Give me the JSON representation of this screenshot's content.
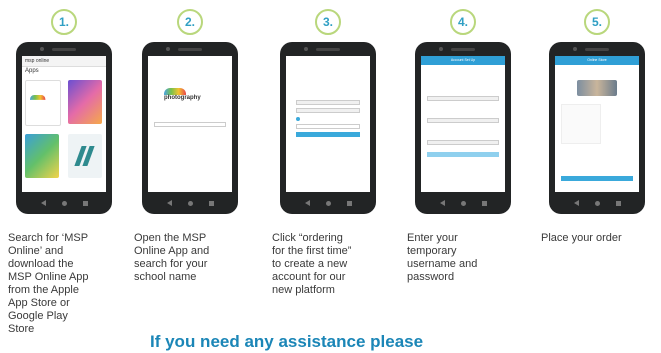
{
  "steps": [
    {
      "number": "1.",
      "caption": "Search for ‘MSP\nOnline’ and\ndownload the\nMSP Online App\nfrom the Apple\nApp Store or\nGoogle Play\nStore",
      "screen": {
        "search_text": "msp online",
        "section": "Apps"
      }
    },
    {
      "number": "2.",
      "caption": "Open the MSP\nOnline App and\nsearch for your\nschool name",
      "screen": {
        "logo_text": "photography"
      }
    },
    {
      "number": "3.",
      "caption": "Click “ordering\nfor the first time”\nto create a new\naccount for our\nnew platform",
      "screen": {
        "logo_text": "photography"
      }
    },
    {
      "number": "4.",
      "caption": "Enter your\ntemporary\nusername and\npassword",
      "screen": {
        "header": "Account Set Up"
      }
    },
    {
      "number": "5.",
      "caption": "Place your order",
      "screen": {
        "header": "Online Store"
      }
    }
  ],
  "footer_text": "If you need any assistance please",
  "colors": {
    "accent_blue": "#1b86b7",
    "circle_border": "#b9d77c",
    "number_color": "#2f9fc4"
  }
}
